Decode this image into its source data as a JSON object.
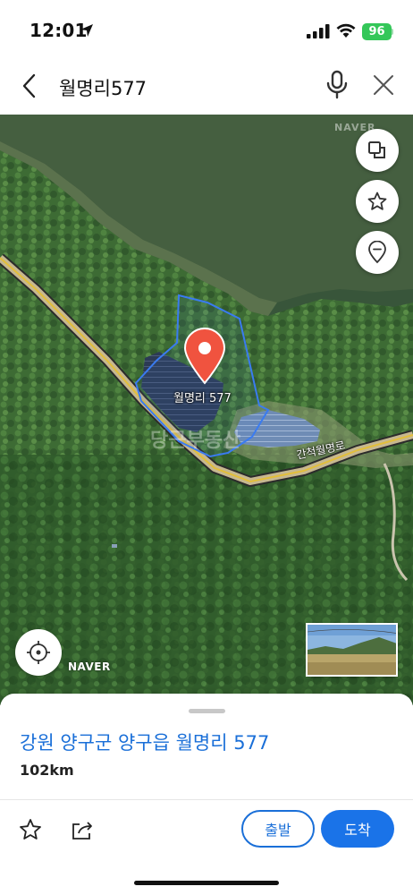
{
  "status_bar": {
    "time": "12:01",
    "battery": "96"
  },
  "search": {
    "query": "월명리577"
  },
  "map": {
    "brand_top": "NAVER",
    "brand_bottom": "NAVER",
    "place_label": "월명리 577",
    "road_label": "간척월명로",
    "watermark": "당근부동산",
    "buttons": [
      "layers",
      "favorite",
      "pin"
    ]
  },
  "sheet": {
    "address": "강원 양구군 양구읍 월명리 577",
    "distance": "102km",
    "depart_label": "출발",
    "arrive_label": "도착"
  },
  "colors": {
    "accent": "#1a73e8",
    "marker": "#f0533f",
    "battery": "#34c759"
  }
}
